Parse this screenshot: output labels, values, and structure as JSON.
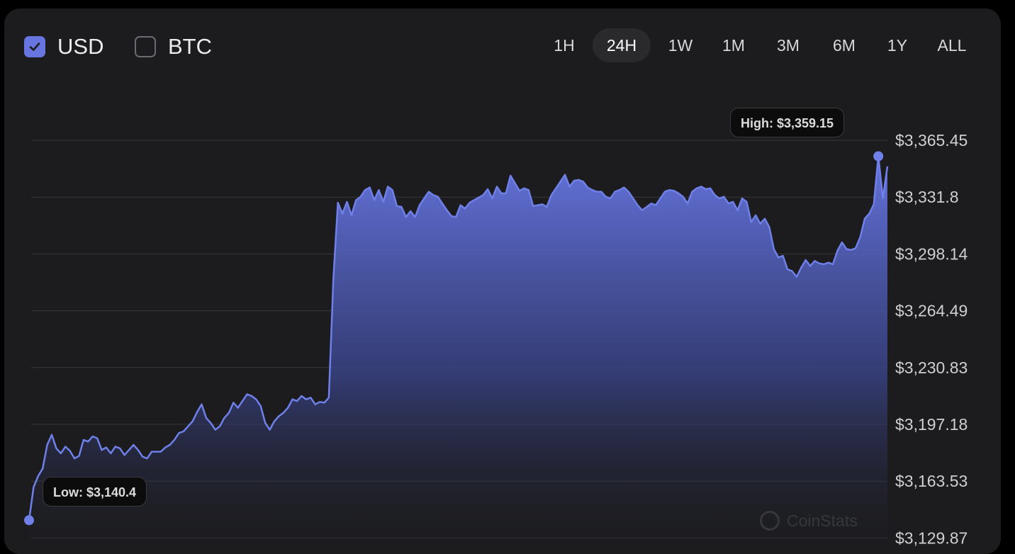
{
  "currency_toggles": [
    {
      "label": "USD",
      "checked": true
    },
    {
      "label": "BTC",
      "checked": false
    }
  ],
  "timeframes": [
    "1H",
    "24H",
    "1W",
    "1M",
    "3M",
    "6M",
    "1Y",
    "ALL"
  ],
  "active_timeframe": "24H",
  "tooltips": {
    "high": "High: $3,359.15",
    "low": "Low: $3,140.4"
  },
  "watermark": "CoinStats",
  "colors": {
    "accent": "#6675e0",
    "line": "#6f80e8",
    "background": "#1c1c1e",
    "grid": "#38383b"
  },
  "chart_data": {
    "type": "area",
    "title": "",
    "xlabel": "",
    "ylabel": "",
    "y_ticks": [
      "$3,365.45",
      "$3,331.8",
      "$3,298.14",
      "$3,264.49",
      "$3,230.83",
      "$3,197.18",
      "$3,163.53",
      "$3,129.87"
    ],
    "ylim": [
      3129.87,
      3365.45
    ],
    "grid": true,
    "high": 3359.15,
    "low": 3140.4,
    "series": [
      {
        "values": [
          3140.4,
          3160.0,
          3166.5,
          3171.0,
          3185.0,
          3191.0,
          3183.0,
          3180.0,
          3184.0,
          3181.5,
          3177.0,
          3178.5,
          3188.0,
          3187.0,
          3190.0,
          3189.0,
          3182.0,
          3183.5,
          3180.0,
          3184.0,
          3183.0,
          3179.0,
          3182.0,
          3185.0,
          3182.0,
          3178.0,
          3177.0,
          3181.0,
          3181.0,
          3181.0,
          3183.5,
          3185.0,
          3188.0,
          3192.0,
          3193.0,
          3196.0,
          3199.0,
          3204.5,
          3209.0,
          3201.0,
          3198.0,
          3194.0,
          3196.0,
          3201.0,
          3204.0,
          3210.0,
          3207.0,
          3211.0,
          3215.0,
          3214.0,
          3212.0,
          3208.0,
          3198.0,
          3194.0,
          3199.0,
          3202.0,
          3204.0,
          3207.0,
          3212.0,
          3211.0,
          3214.0,
          3212.0,
          3213.0,
          3209.0,
          3210.5,
          3210.0,
          3213.0,
          3283.0,
          3328.5,
          3322.0,
          3329.0,
          3321.0,
          3330.0,
          3332.0,
          3336.0,
          3337.5,
          3330.0,
          3336.0,
          3329.0,
          3338.0,
          3336.0,
          3326.5,
          3326.0,
          3320.0,
          3323.5,
          3320.0,
          3327.0,
          3331.0,
          3335.0,
          3333.0,
          3332.0,
          3328.0,
          3324.0,
          3320.5,
          3320.0,
          3327.0,
          3325.0,
          3328.5,
          3330.0,
          3331.5,
          3333.0,
          3336.5,
          3331.0,
          3338.0,
          3334.0,
          3334.0,
          3344.5,
          3340.0,
          3335.5,
          3337.0,
          3336.0,
          3326.5,
          3327.0,
          3327.5,
          3326.0,
          3333.0,
          3337.0,
          3341.0,
          3345.0,
          3338.0,
          3341.5,
          3342.0,
          3341.0,
          3337.5,
          3336.0,
          3335.0,
          3335.0,
          3332.0,
          3331.0,
          3335.0,
          3336.0,
          3337.5,
          3335.0,
          3331.0,
          3327.0,
          3324.0,
          3326.0,
          3328.0,
          3327.0,
          3331.0,
          3335.0,
          3336.0,
          3335.5,
          3334.0,
          3332.0,
          3328.0,
          3335.0,
          3337.0,
          3338.0,
          3336.5,
          3337.0,
          3333.0,
          3331.0,
          3332.0,
          3328.0,
          3329.0,
          3324.0,
          3331.0,
          3329.0,
          3317.0,
          3321.0,
          3316.0,
          3319.0,
          3314.0,
          3301.0,
          3296.0,
          3297.0,
          3289.0,
          3288.0,
          3284.5,
          3290.0,
          3294.5,
          3291.0,
          3294.0,
          3292.5,
          3292.0,
          3293.0,
          3292.0,
          3300.0,
          3305.0,
          3301.0,
          3300.5,
          3301.5,
          3308.0,
          3319.0,
          3322.0,
          3327.5,
          3356.0,
          3331.0,
          3350.0
        ]
      }
    ]
  }
}
